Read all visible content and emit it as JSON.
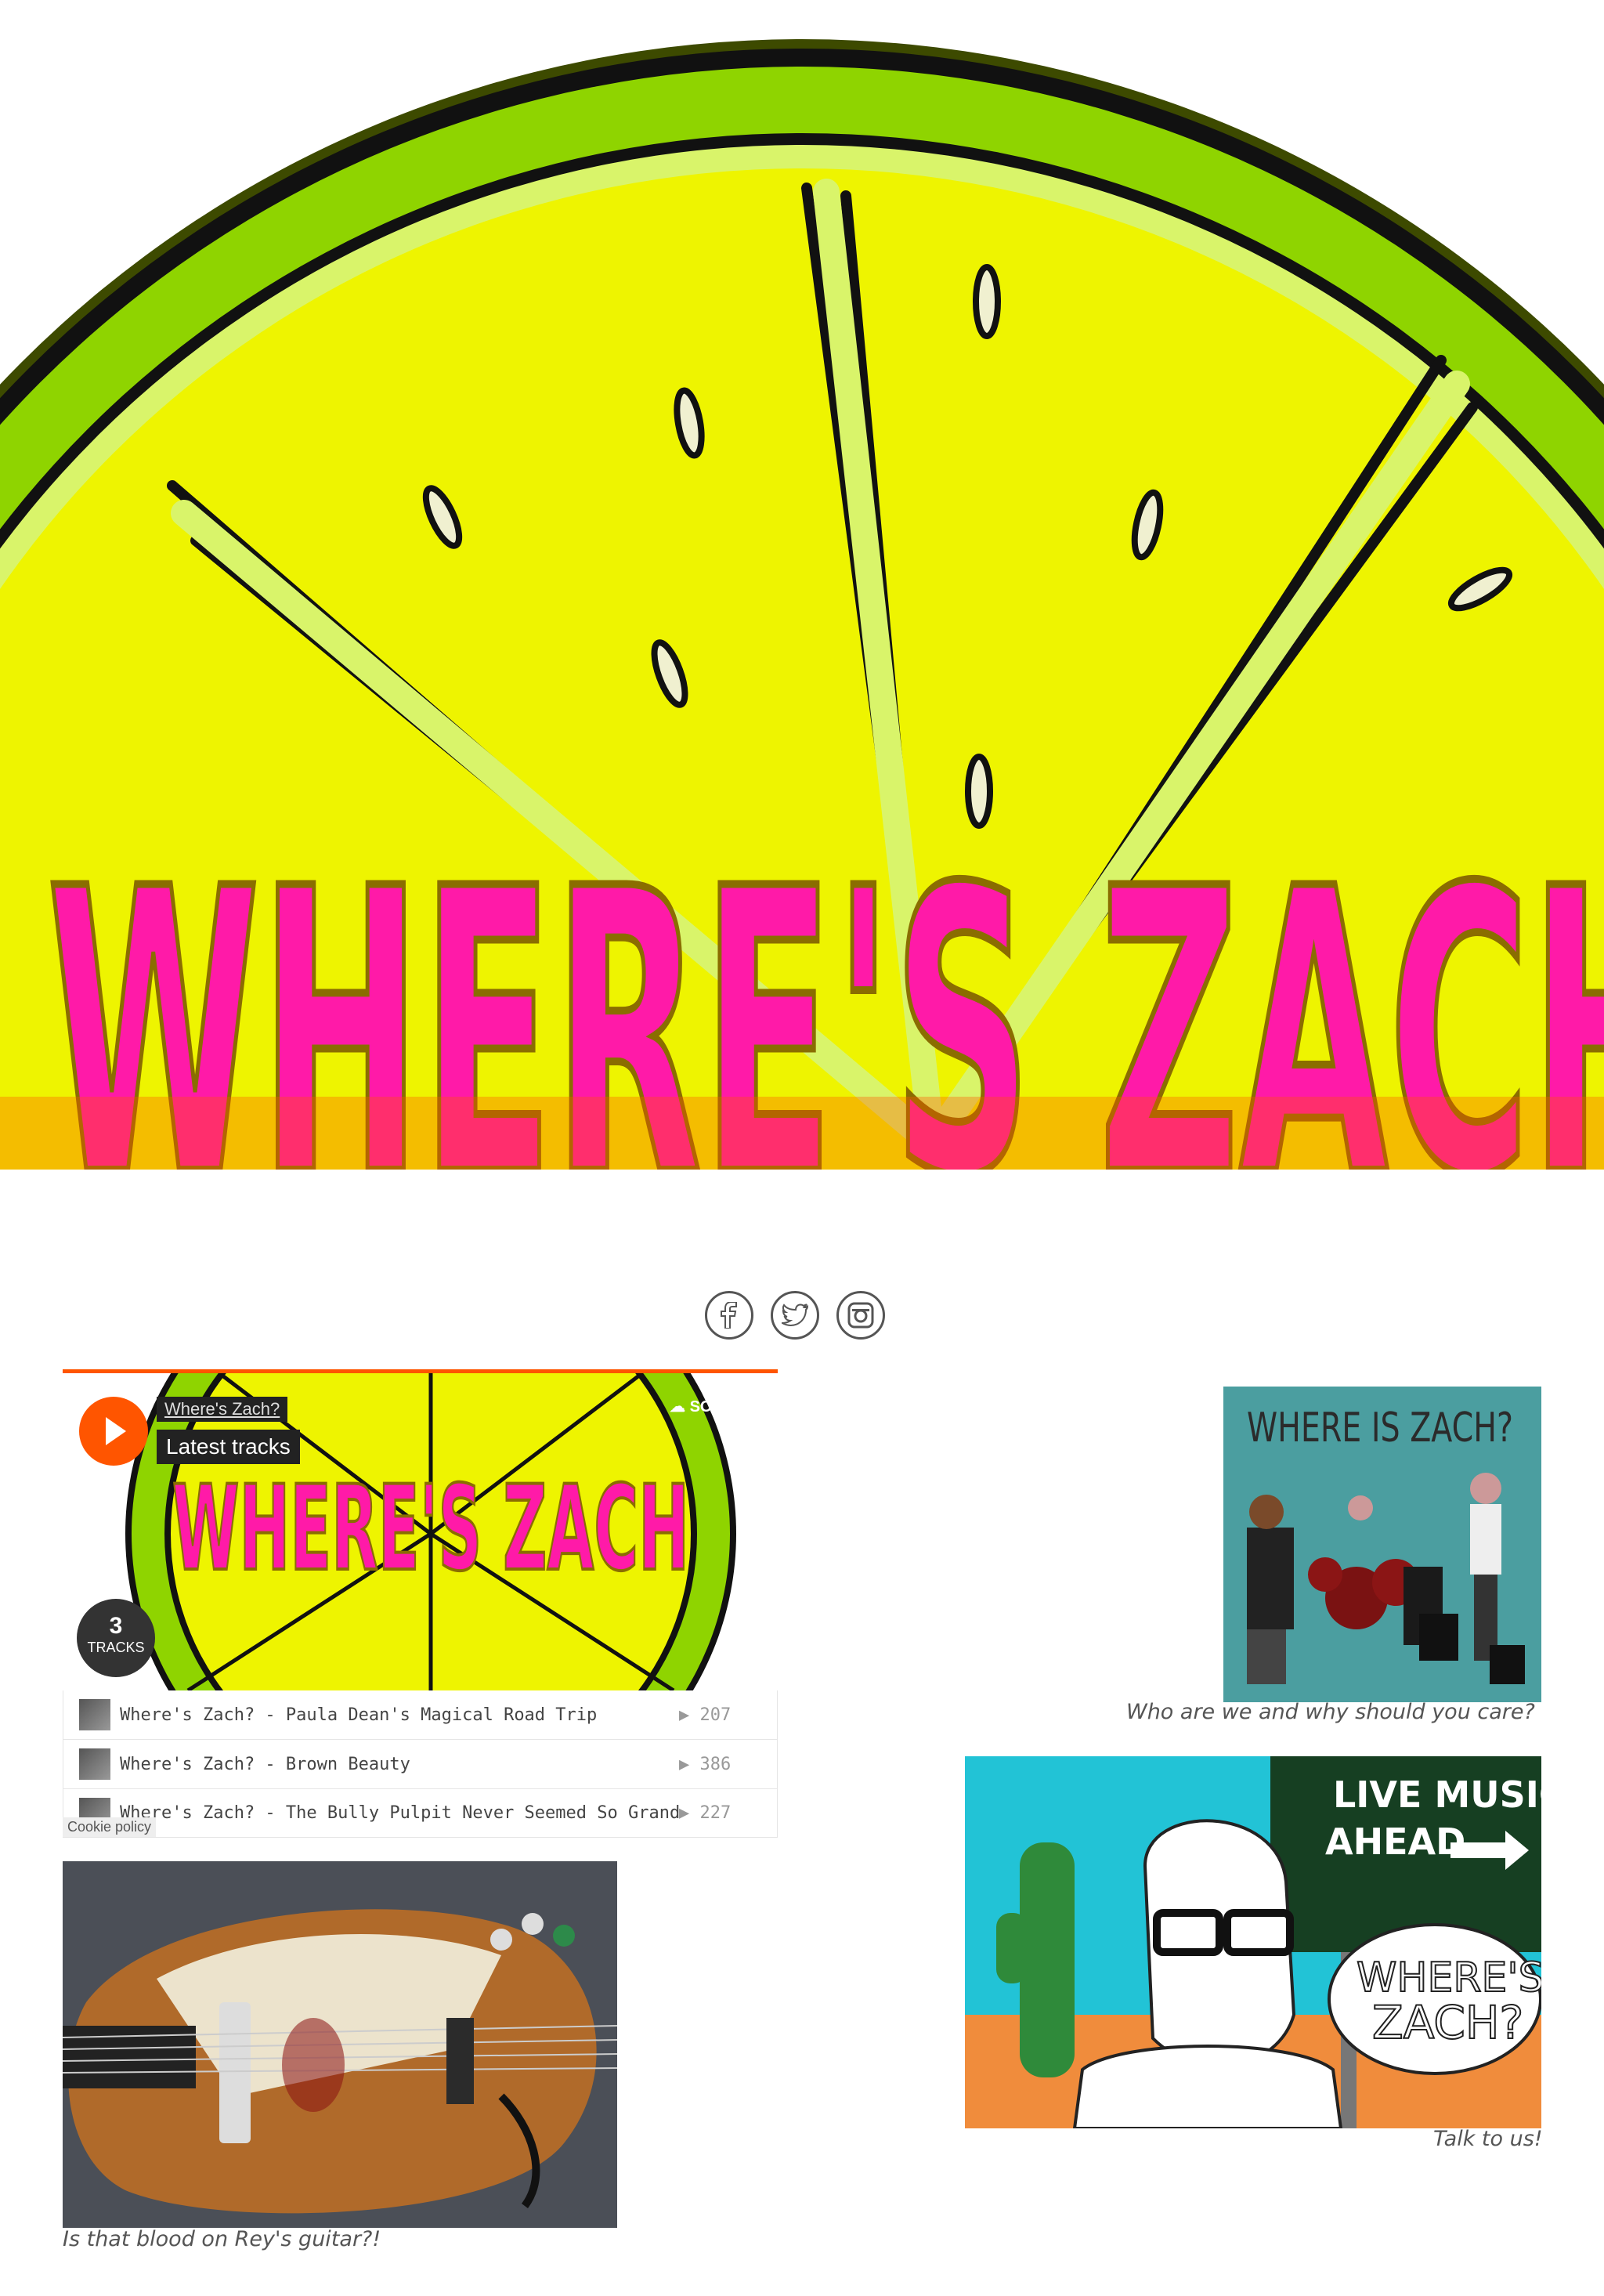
{
  "hero": {
    "logo_text": "WHERE'S ZACH"
  },
  "social": {
    "items": [
      "facebook-icon",
      "twitter-icon",
      "instagram-icon"
    ]
  },
  "player": {
    "artist": "Where's Zach?",
    "title": "Latest tracks",
    "brand": "SOUNDCL",
    "track_count": "3",
    "tracks_label": "TRACKS",
    "tracks": [
      {
        "name": "Where's Zach? - Paula Dean's Magical Road Trip",
        "plays": "207"
      },
      {
        "name": "Where's Zach? - Brown Beauty",
        "plays": "386"
      },
      {
        "name": "Where's Zach? - The Bully Pulpit Never Seemed So Grand",
        "plays": "227"
      }
    ],
    "cookie": "Cookie policy"
  },
  "cards": {
    "band": {
      "art_text": "WHERE IS ZACH?",
      "caption": "Who are we and why should you care?"
    },
    "live": {
      "sign_line1": "LIVE MUSIC",
      "sign_line2": "AHEAD",
      "bubble_line1": "WHERE'S",
      "bubble_line2": "ZACH?",
      "caption": "Talk to us!"
    },
    "guitar": {
      "caption": "Is that blood on Rey's guitar?!"
    }
  },
  "colors": {
    "lime_rind": "#8fd400",
    "lime_flesh": "#eef400",
    "pink": "#ff1aa8",
    "orange": "#ff5500",
    "teal": "#4b9ea0"
  }
}
